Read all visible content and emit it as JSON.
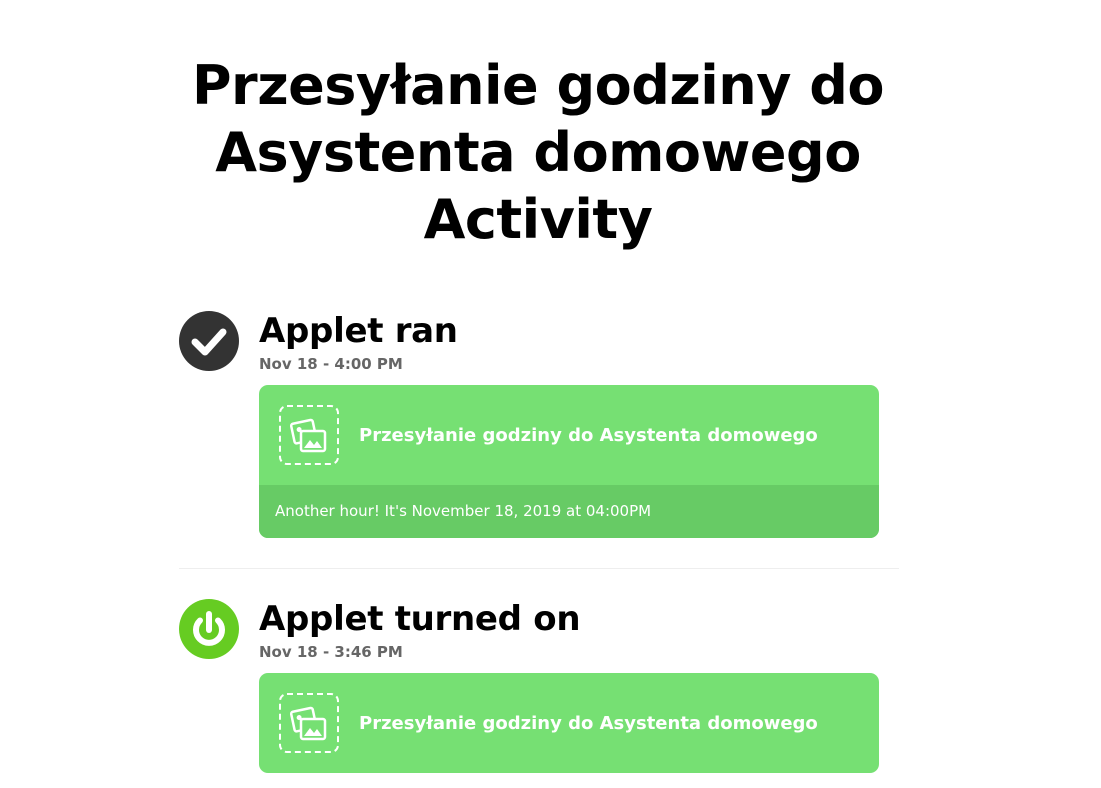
{
  "page": {
    "title": "Przesyłanie godziny do Asystenta domowego Activity"
  },
  "events": [
    {
      "title": "Applet ran",
      "time": "Nov 18 - 4:00 PM",
      "icon": "check-circle-icon",
      "icon_color": "#333333",
      "applet_name": "Przesyłanie godziny do Asystenta domowego",
      "message": "Another hour! It's November 18, 2019 at 04:00PM"
    },
    {
      "title": "Applet turned on",
      "time": "Nov 18 - 3:46 PM",
      "icon": "power-icon",
      "icon_color": "#66cc22",
      "applet_name": "Przesyłanie godziny do Asystenta domowego"
    }
  ],
  "colors": {
    "card_background": "#76e073",
    "card_footer": "#67cb65",
    "timestamp": "#666666"
  }
}
